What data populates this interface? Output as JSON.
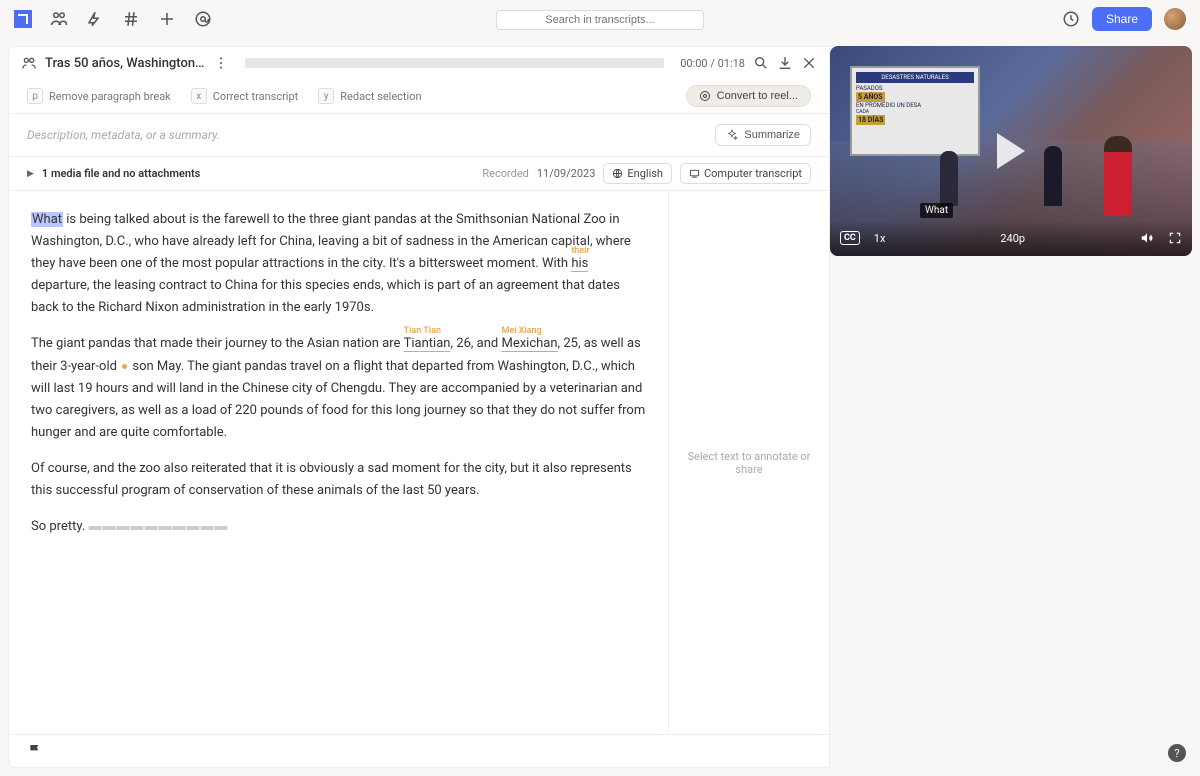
{
  "topbar": {
    "search_placeholder": "Search in transcripts...",
    "share": "Share"
  },
  "header": {
    "title": "Tras 50 años, Washington ...",
    "time_current": "00:00",
    "time_total": "01:18"
  },
  "toolbar": {
    "p_key": "p",
    "p_label": "Remove paragraph break",
    "x_key": "x",
    "x_label": "Correct transcript",
    "y_key": "y",
    "y_label": "Redact selection",
    "convert": "Convert to reel..."
  },
  "meta": {
    "desc_placeholder": "Description, metadata, or a summary.",
    "summarize": "Summarize",
    "attachments": "1 media file and no attachments",
    "recorded_label": "Recorded",
    "recorded_date": "11/09/2023",
    "language": "English",
    "transcript_type": "Computer transcript"
  },
  "transcript": {
    "p1_a": "What",
    "p1_b": " is being talked about is the farewell to the three giant pandas at the Smithsonian National Zoo in Washington, D.C., who have already left for China, leaving a bit of sadness in the American capital, where they have been one of the most popular attractions in the city. It's a bittersweet moment. With ",
    "p1_his": "his",
    "p1_his_anno": "their",
    "p1_c": " departure, the leasing contract to China for this species ends, which is part of an agreement that dates back to the Richard Nixon administration in the early 1970s.",
    "p2_a": "The giant pandas that made their journey to the Asian nation are ",
    "p2_tiantian": "Tiantian",
    "p2_tiantian_anno": "Tian Tian",
    "p2_b": ", 26, and ",
    "p2_mexichan": "Mexichan",
    "p2_mexichan_anno": "Mei Xiang",
    "p2_c": ", 25, as well as their 3-year-old ",
    "p2_d": " son May. The giant pandas travel on a flight that departed from Washington, D.C., which will last 19 hours and will land in the Chinese city of Chengdu. They are accompanied by a veterinarian and two caregivers, as well as a load of 220 pounds of food for this long journey so that they do not suffer from hunger and are quite comfortable.",
    "p3": "Of course, and the zoo also reiterated that it is obviously a sad moment for the city, but it also represents this successful program of conservation of these animals of the last 50 years.",
    "p4_a": "So pretty. ",
    "p4_redacted": "▬▬▬▬▬▬▬▬▬▬"
  },
  "annotation_panel": "Select text to annotate or share",
  "video": {
    "caption": "What",
    "cc": "CC",
    "speed": "1x",
    "quality": "240p",
    "board_title": "DESASTRES NATURALES",
    "board_l1": "PASADOS",
    "board_l2": "5 AÑOS",
    "board_l3": "EN PROMEDIO UN DESA",
    "board_l4": "18 DÍAS"
  }
}
